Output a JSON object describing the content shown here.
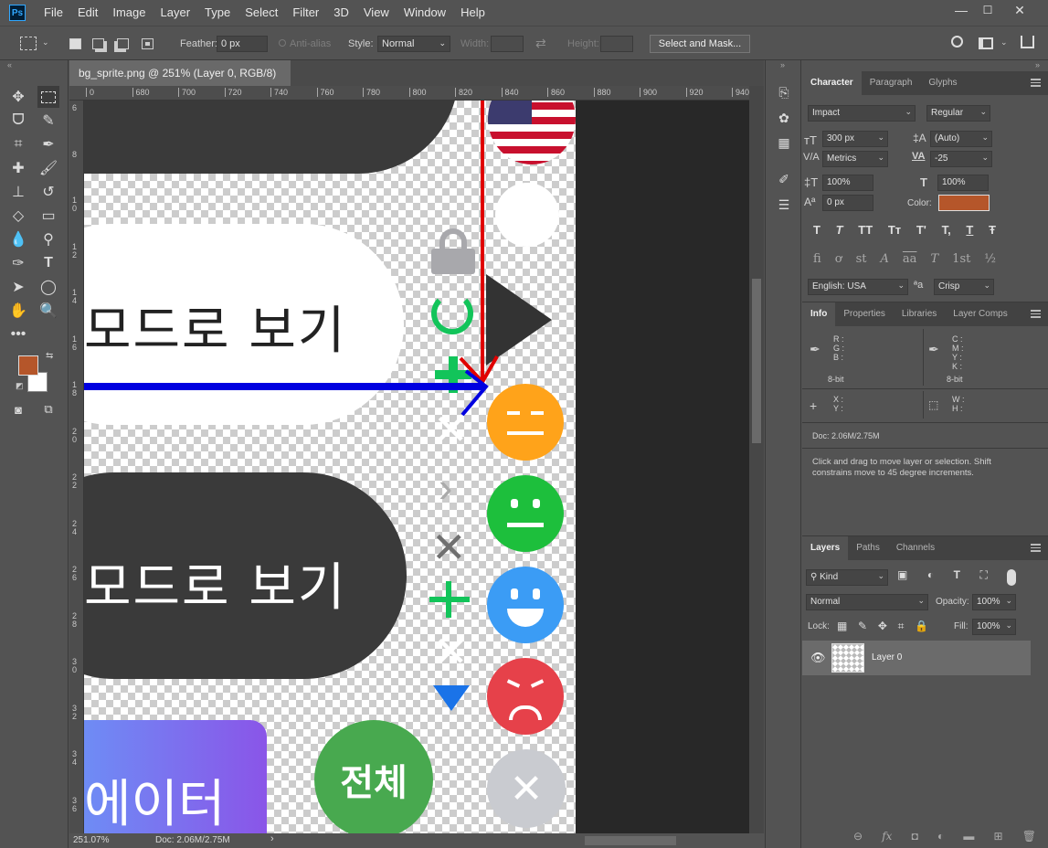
{
  "app": {
    "logo": "Ps"
  },
  "menu": [
    "File",
    "Edit",
    "Image",
    "Layer",
    "Type",
    "Select",
    "Filter",
    "3D",
    "View",
    "Window",
    "Help"
  ],
  "window_controls": {
    "minimize": "—",
    "maximize": "☐",
    "close": "✕"
  },
  "options": {
    "feather_label": "Feather:",
    "feather_value": "0 px",
    "antialias_label": "Anti-alias",
    "style_label": "Style:",
    "style_value": "Normal",
    "width_label": "Width:",
    "height_label": "Height:",
    "select_mask_button": "Select and Mask..."
  },
  "document": {
    "tab_title": "bg_sprite.png @ 251% (Layer 0, RGB/8)",
    "tab_close": "×",
    "ruler_top": [
      "0",
      "680",
      "700",
      "720",
      "740",
      "760",
      "780",
      "800",
      "820",
      "840",
      "860",
      "880",
      "900",
      "920",
      "940"
    ],
    "ruler_left": [
      "6",
      "8",
      "1\n0",
      "1\n2",
      "1\n4",
      "1\n6",
      "1\n8",
      "2\n0",
      "2\n2",
      "2\n4",
      "2\n6",
      "2\n8",
      "3\n0",
      "3\n2",
      "3\n4",
      "3\n6"
    ],
    "zoom": "251.07%",
    "doc_size": "Doc: 2.06M/2.75M"
  },
  "canvas": {
    "button1_text": "모드로 보기",
    "button2_text": "모드로 보기",
    "gradient_text": "에이터",
    "green_circle_text": "전체",
    "colors": {
      "dark": "#3a3a3a",
      "orange": "#ffa31a",
      "green": "#1dbf3c",
      "blue": "#3b9cf5",
      "red": "#e6414a",
      "grey": "#c9cbd0",
      "green_circle": "#48a94f",
      "red_arrow": "#e00000",
      "blue_arrow": "#0000e0",
      "plus_green": "#12c45a"
    }
  },
  "character_panel": {
    "tabs": [
      "Character",
      "Paragraph",
      "Glyphs"
    ],
    "font_family": "Impact",
    "font_style": "Regular",
    "size": "300 px",
    "leading": "(Auto)",
    "kerning": "Metrics",
    "tracking": "-25",
    "vscale": "100%",
    "hscale": "100%",
    "baseline": "0 px",
    "color_label": "Color:",
    "color_value": "#b5562a",
    "style_buttons": [
      "T",
      "T",
      "TT",
      "Tт",
      "T'",
      "T,",
      "T",
      "Ŧ"
    ],
    "ot_buttons": [
      "fi",
      "ơ",
      "st",
      "A",
      "aa",
      "T",
      "1st",
      "½"
    ],
    "language": "English: USA",
    "aa_label": "ªa",
    "antialias": "Crisp"
  },
  "info_panel": {
    "tabs": [
      "Info",
      "Properties",
      "Libraries",
      "Layer Comps"
    ],
    "rgb_labels": [
      "R :",
      "G :",
      "B :"
    ],
    "cmyk_labels": [
      "C :",
      "M :",
      "Y :",
      "K :"
    ],
    "bit_left": "8-bit",
    "bit_right": "8-bit",
    "xy_labels": [
      "X :",
      "Y :"
    ],
    "wh_labels": [
      "W :",
      "H :"
    ],
    "doc_size": "Doc: 2.06M/2.75M",
    "hint": "Click and drag to move layer or selection. Shift constrains move to 45 degree increments."
  },
  "layers_panel": {
    "tabs": [
      "Layers",
      "Paths",
      "Channels"
    ],
    "filter_kind": "Kind",
    "blend_mode": "Normal",
    "opacity_label": "Opacity:",
    "opacity_value": "100%",
    "lock_label": "Lock:",
    "fill_label": "Fill:",
    "fill_value": "100%",
    "layer_name": "Layer 0"
  }
}
